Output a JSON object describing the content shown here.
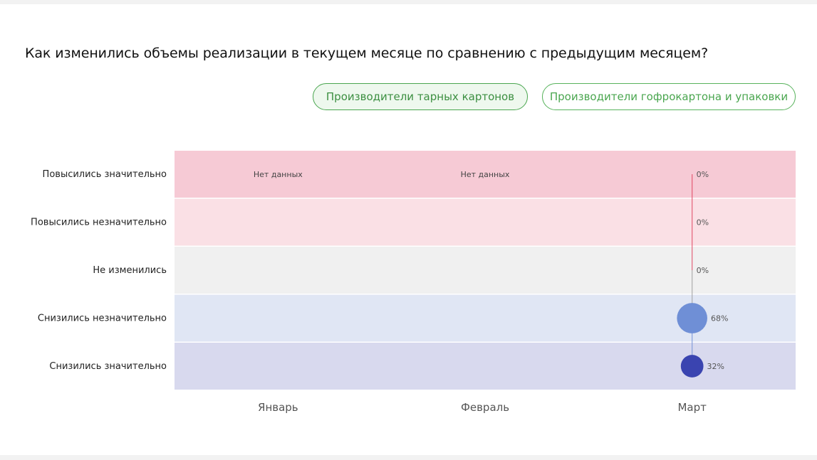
{
  "page": {
    "title": "Как изменились объемы реализации в текущем месяце по сравнению с предыдущим месяцем?"
  },
  "tabs": [
    {
      "label": "Производители тарных картонов",
      "active": true
    },
    {
      "label": "Производители гофрокартона и упаковки",
      "active": false
    }
  ],
  "chart_data": {
    "type": "scatter",
    "categories": [
      "Повысились значительно",
      "Повысились незначительно",
      "Не изменились",
      "Снизились незначительно",
      "Снизились значительно"
    ],
    "x": [
      "Январь",
      "Февраль",
      "Март"
    ],
    "series": [
      {
        "x": "Январь",
        "no_data_label": "Нет данных",
        "values": null
      },
      {
        "x": "Февраль",
        "no_data_label": "Нет данных",
        "values": null
      },
      {
        "x": "Март",
        "values": [
          0,
          0,
          0,
          68,
          32
        ],
        "labels": [
          "0%",
          "0%",
          "0%",
          "68%",
          "32%"
        ]
      }
    ],
    "band_colors": [
      "#f6cad5",
      "#fae0e5",
      "#f0f0f0",
      "#e0e6f4",
      "#d8d9ee"
    ],
    "point_colors": [
      "#e0405c",
      "#e0405c",
      "#9e9e9e",
      "#6f8fd6",
      "#3a44b0"
    ],
    "unit": "%"
  }
}
